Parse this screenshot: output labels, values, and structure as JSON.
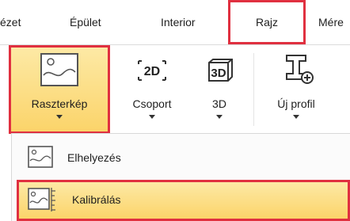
{
  "tabs": [
    {
      "label": "ézet"
    },
    {
      "label": "Épület"
    },
    {
      "label": "Interior"
    },
    {
      "label": "Rajz"
    },
    {
      "label": "Mére"
    }
  ],
  "ribbon": {
    "buttons": [
      {
        "label": "Raszterkép",
        "icon": "raster-image-icon"
      },
      {
        "label": "Csoport",
        "icon": "group-2d-icon"
      },
      {
        "label": "3D",
        "icon": "3d-icon"
      },
      {
        "label": "Új profil",
        "icon": "new-profile-icon"
      }
    ]
  },
  "dropdown": {
    "items": [
      {
        "label": "Elhelyezés",
        "icon": "place-image-icon"
      },
      {
        "label": "Kalibrálás",
        "icon": "calibrate-image-icon"
      }
    ]
  },
  "colors": {
    "highlight_border": "#e03040",
    "selection_fill": "#fbd46a"
  }
}
